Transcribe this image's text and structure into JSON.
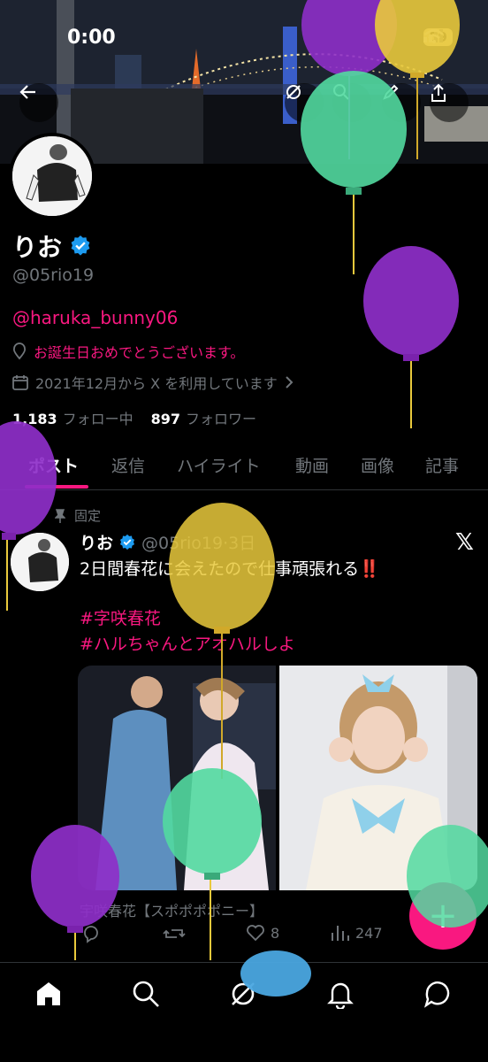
{
  "status_bar": {
    "time": "0:00",
    "battery": "59"
  },
  "profile": {
    "name": "りお",
    "handle": "@05rio19",
    "bio_mention": "@haruka_bunny06",
    "location": "お誕生日おめでとうございます。",
    "joined": "2021年12月から X を利用しています",
    "following_count": "1,183",
    "following_label": "フォロー中",
    "followers_count": "897",
    "followers_label": "フォロワー"
  },
  "tabs": [
    {
      "label": "ポスト"
    },
    {
      "label": "返信"
    },
    {
      "label": "ハイライト"
    },
    {
      "label": "動画"
    },
    {
      "label": "画像"
    },
    {
      "label": "記事"
    }
  ],
  "post": {
    "pinned_label": "固定",
    "author": "りお",
    "meta": "@05rio19·3日",
    "text": "2日間春花に会えたので仕事頑張れる‼️",
    "hashtags": [
      "#字咲春花",
      "#ハルちゃんとアオハルしよ"
    ],
    "caption": "宇咲春花【スポポポポニー】",
    "likes": "8",
    "views": "247"
  },
  "icons": {
    "back": "back-arrow-icon",
    "search": "search-icon",
    "share": "share-icon",
    "home": "home-icon",
    "explore": "search-icon",
    "grok": "grok-icon",
    "notifications": "bell-icon",
    "messages": "message-icon"
  },
  "colors": {
    "accent": "#f91880",
    "verified": "#1d9bf0",
    "balloon_purple": "#8e2fc9",
    "balloon_yellow": "#e9c93c",
    "balloon_green": "#52d9a0"
  }
}
